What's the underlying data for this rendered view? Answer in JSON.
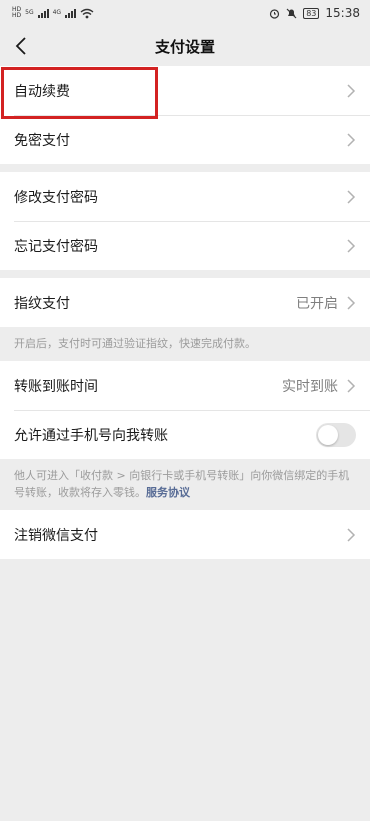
{
  "status_bar": {
    "sim_tags": [
      "HD",
      "HD"
    ],
    "net_1": "5G",
    "net_2": "4G",
    "battery": "83",
    "time": "15:38",
    "icons": [
      "signal-icon",
      "wifi-icon",
      "alarm-icon",
      "mute-icon",
      "battery-icon"
    ]
  },
  "nav": {
    "title": "支付设置",
    "back_icon": "chevron-left-icon"
  },
  "group1": {
    "items": [
      {
        "label": "自动续费"
      },
      {
        "label": "免密支付"
      }
    ]
  },
  "group2": {
    "items": [
      {
        "label": "修改支付密码"
      },
      {
        "label": "忘记支付密码"
      }
    ]
  },
  "group3": {
    "fingerprint": {
      "label": "指纹支付",
      "value": "已开启"
    },
    "hint": "开启后，支付时可通过验证指纹，快速完成付款。"
  },
  "group4": {
    "transfer_time": {
      "label": "转账到账时间",
      "value": "实时到账"
    },
    "allow_phone": {
      "label": "允许通过手机号向我转账",
      "enabled": false
    },
    "hint": "他人可进入「收付款 > 向银行卡或手机号转账」向你微信绑定的手机号转账，收款将存入零钱。",
    "link": "服务协议"
  },
  "group5": {
    "items": [
      {
        "label": "注销微信支付"
      }
    ]
  },
  "colors": {
    "background": "#ededed",
    "link": "#576b95",
    "highlight": "#d32222"
  }
}
